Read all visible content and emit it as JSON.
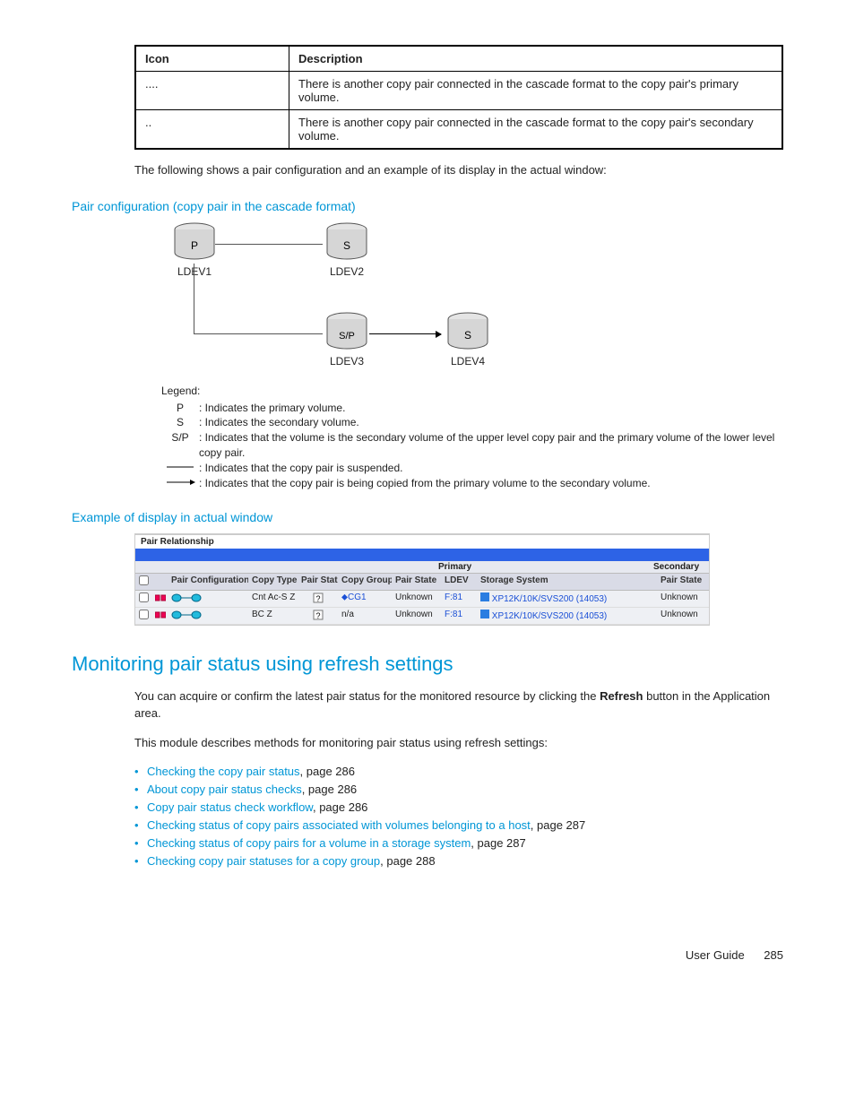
{
  "iconTable": {
    "headers": {
      "c1": "Icon",
      "c2": "Description"
    },
    "rows": [
      {
        "icon": "....",
        "desc": "There is another copy pair connected in the cascade format to the copy pair's primary volume."
      },
      {
        "icon": "..",
        "desc": "There is another copy pair connected in the cascade format to the copy pair's secondary volume."
      }
    ]
  },
  "intro": "The following shows a pair configuration and an example of its display in the actual window:",
  "caption1": "Pair configuration (copy pair in the cascade format)",
  "diagram": {
    "nodes": {
      "n1": "P",
      "n1l": "LDEV1",
      "n2": "S",
      "n2l": "LDEV2",
      "n3": "S/P",
      "n3l": "LDEV3",
      "n4": "S",
      "n4l": "LDEV4"
    }
  },
  "legend": {
    "title": "Legend:",
    "rows": [
      {
        "sym": "P",
        "txt": "Indicates the primary volume."
      },
      {
        "sym": "S",
        "txt": "Indicates the secondary volume."
      },
      {
        "sym": "S/P",
        "txt": "Indicates that the volume is the secondary volume of the upper level copy pair and the primary volume of the lower level copy pair."
      },
      {
        "sym": "line",
        "txt": "Indicates that the copy pair is suspended."
      },
      {
        "sym": "arrow",
        "txt": "Indicates that the copy pair is being copied from the primary volume to the secondary volume."
      }
    ]
  },
  "caption2": "Example of display in actual window",
  "screenshot": {
    "title": "Pair Relationship",
    "topHeaders": {
      "pc": "Pair Configuration▽",
      "ct": "Copy Type",
      "ps": "Pair Status",
      "cg": "Copy Group",
      "primary": "Primary",
      "secondary": "Secondary"
    },
    "subHeaders": {
      "pst": "Pair State",
      "ldev": "LDEV",
      "ss": "Storage System",
      "pst2": "Pair State"
    },
    "rows": [
      {
        "ct": "Cnt Ac-S Z",
        "cg": "CG1",
        "pst": "Unknown",
        "ldev": "F:81",
        "ss": "XP12K/10K/SVS200 (14053)",
        "sec": "Unknown"
      },
      {
        "ct": "BC Z",
        "cg": "n/a",
        "pst": "Unknown",
        "ldev": "F:81",
        "ss": "XP12K/10K/SVS200 (14053)",
        "sec": "Unknown"
      }
    ]
  },
  "section": {
    "heading": "Monitoring pair status using refresh settings",
    "p1a": "You can acquire or confirm the latest pair status for the monitored resource by clicking the ",
    "p1b": "Refresh",
    "p1c": " button in the Application area.",
    "p2": "This module describes methods for monitoring pair status using refresh settings:",
    "links": [
      {
        "t": "Checking the copy pair status",
        "p": ", page 286"
      },
      {
        "t": "About copy pair status checks",
        "p": ", page 286"
      },
      {
        "t": "Copy pair status check workflow",
        "p": ", page 286"
      },
      {
        "t": "Checking status of copy pairs associated with volumes belonging to a host",
        "p": ", page 287"
      },
      {
        "t": "Checking status of copy pairs for a volume in a storage system",
        "p": ", page 287"
      },
      {
        "t": "Checking copy pair statuses for a copy group",
        "p": ", page 288"
      }
    ]
  },
  "footer": {
    "title": "User Guide",
    "page": "285"
  }
}
